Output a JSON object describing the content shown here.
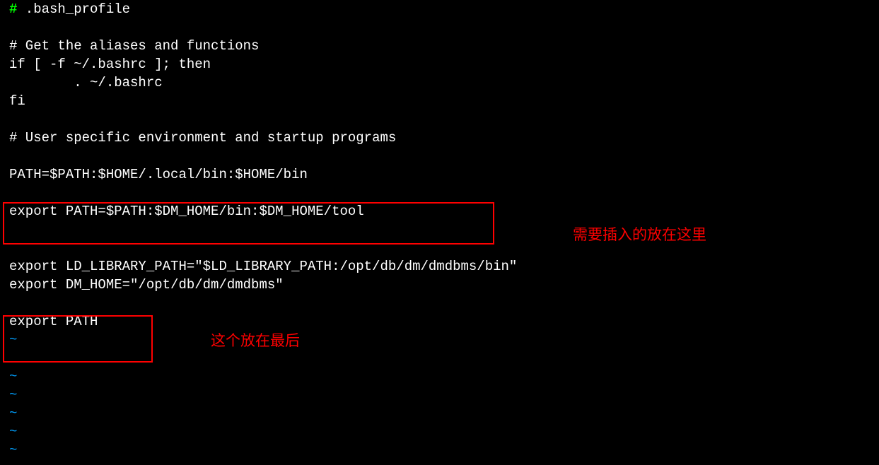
{
  "code": {
    "hash": "#",
    "line1_rest": " .bash_profile",
    "line2": "",
    "line3": "# Get the aliases and functions",
    "line4": "if [ -f ~/.bashrc ]; then",
    "line5": "        . ~/.bashrc",
    "line6": "fi",
    "line7": "",
    "line8": "# User specific environment and startup programs",
    "line9": "",
    "line10": "PATH=$PATH:$HOME/.local/bin:$HOME/bin",
    "line11": "",
    "line12": "export PATH=$PATH:$DM_HOME/bin:$DM_HOME/tool",
    "line13": "",
    "line14": "",
    "line15": "export LD_LIBRARY_PATH=\"$LD_LIBRARY_PATH:/opt/db/dm/dmdbms/bin\"",
    "line16": "export DM_HOME=\"/opt/db/dm/dmdbms\"",
    "line17": "",
    "line18": "export PATH",
    "tilde": "~"
  },
  "annotations": {
    "note1": "需要插入的放在这里",
    "note2": "这个放在最后"
  }
}
